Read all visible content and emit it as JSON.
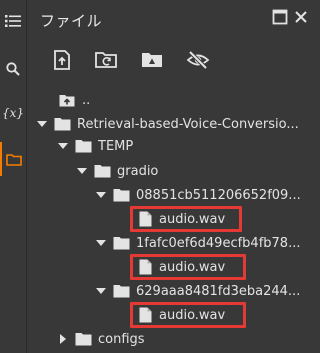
{
  "panel": {
    "title": "ファイル"
  },
  "toolbar": {
    "buttons": [
      {
        "icon": "upload-file-icon"
      },
      {
        "icon": "refresh-folder-icon"
      },
      {
        "icon": "drive-folder-icon"
      },
      {
        "icon": "visibility-off-icon"
      }
    ]
  },
  "rail": {
    "items": [
      {
        "icon": "menu-list-icon"
      },
      {
        "icon": "search-icon"
      },
      {
        "icon": "variables-icon",
        "text": "{x}"
      },
      {
        "icon": "folder-icon"
      }
    ]
  },
  "tree": {
    "parent": "..",
    "root": "Retrieval-based-Voice-Conversio...",
    "temp": "TEMP",
    "gradio": "gradio",
    "dir1": "08851cb511206652f09...",
    "dir2": "1fafc0ef6d49ecfb4fb78...",
    "dir3": "629aaa8481fd3eba244...",
    "file1": "audio.wav",
    "file2": "audio.wav",
    "file3": "audio.wav",
    "configs": "configs"
  },
  "colors": {
    "background": "#383838",
    "highlight_box": "#e53935",
    "active_indicator": "#f57c00"
  }
}
